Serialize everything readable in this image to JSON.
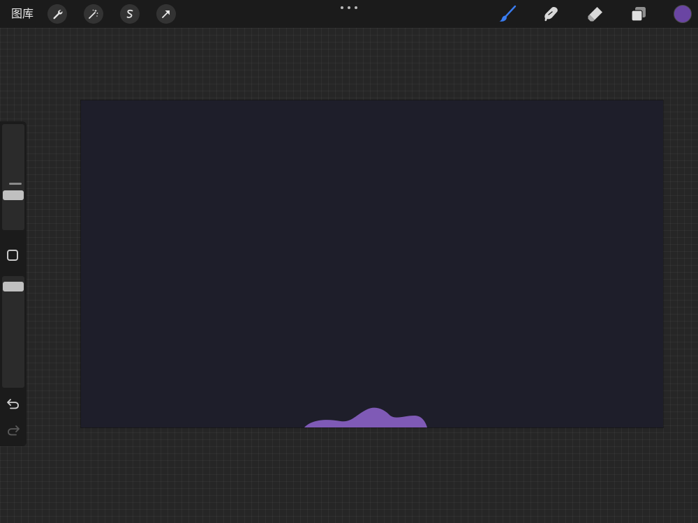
{
  "toolbar": {
    "gallery_label": "图库",
    "left_tools": [
      "wrench-icon",
      "magic-wand-icon",
      "selection-icon",
      "transform-arrow-icon"
    ],
    "right_tools": [
      "brush-icon",
      "smudge-icon",
      "eraser-icon",
      "layers-icon"
    ],
    "active_tool": "brush",
    "active_color": "#6a45a3"
  },
  "canvas": {
    "background_color": "#1e1e2a",
    "stroke_color": "#7f5ab6"
  },
  "sidebar": {
    "brush_size": 0.4,
    "brush_opacity": 1.0,
    "controls": [
      "brush-size-slider",
      "modify-button",
      "opacity-slider",
      "undo-icon",
      "redo-icon"
    ]
  },
  "colors": {
    "accent_active": "#3a7cf0",
    "toolbar_bg": "#1b1b1b",
    "workspace_bg": "#262626"
  }
}
